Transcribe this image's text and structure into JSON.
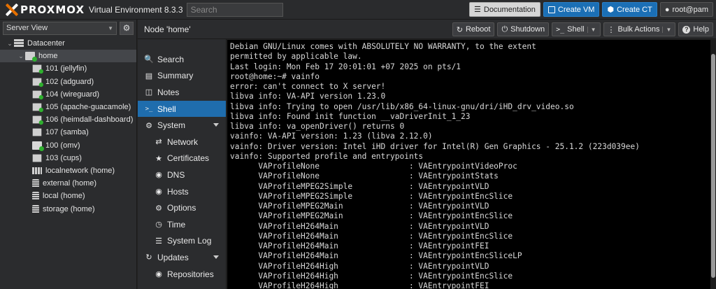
{
  "topbar": {
    "logo": "PROXMOX",
    "version": "Virtual Environment 8.3.3",
    "search_placeholder": "Search",
    "documentation": "Documentation",
    "create_vm": "Create VM",
    "create_ct": "Create CT",
    "user": "root@pam"
  },
  "left": {
    "view": "Server View",
    "tree": [
      {
        "label": "Datacenter",
        "type": "datacenter",
        "indent": 0
      },
      {
        "label": "home",
        "type": "node",
        "indent": 1
      },
      {
        "label": "101 (jellyfin)",
        "type": "vm",
        "indent": 2
      },
      {
        "label": "102 (adguard)",
        "type": "vm",
        "indent": 2
      },
      {
        "label": "104 (wireguard)",
        "type": "vm",
        "indent": 2
      },
      {
        "label": "105 (apache-guacamole)",
        "type": "vm",
        "indent": 2
      },
      {
        "label": "106 (heimdall-dashboard)",
        "type": "vm",
        "indent": 2
      },
      {
        "label": "107 (samba)",
        "type": "ct",
        "indent": 2
      },
      {
        "label": "100 (omv)",
        "type": "qemu",
        "indent": 2
      },
      {
        "label": "103 (cups)",
        "type": "ct-off",
        "indent": 2
      },
      {
        "label": "localnetwork (home)",
        "type": "net",
        "indent": 2
      },
      {
        "label": "external (home)",
        "type": "storage",
        "indent": 2
      },
      {
        "label": "local (home)",
        "type": "storage",
        "indent": 2
      },
      {
        "label": "storage (home)",
        "type": "storage",
        "indent": 2
      }
    ]
  },
  "node": {
    "title": "Node 'home'",
    "reboot": "Reboot",
    "shutdown": "Shutdown",
    "shell": "Shell",
    "bulk": "Bulk Actions",
    "help": "Help"
  },
  "menu": [
    {
      "label": "Search",
      "icon": "search-icon",
      "sub": false
    },
    {
      "label": "Summary",
      "icon": "book-icon",
      "sub": false
    },
    {
      "label": "Notes",
      "icon": "notes-icon",
      "sub": false
    },
    {
      "label": "Shell",
      "icon": "terminal-icon",
      "sub": false,
      "active": true
    },
    {
      "label": "System",
      "icon": "cogs-icon",
      "sub": false,
      "expand": true
    },
    {
      "label": "Network",
      "icon": "network-icon",
      "sub": true
    },
    {
      "label": "Certificates",
      "icon": "certificate-icon",
      "sub": true
    },
    {
      "label": "DNS",
      "icon": "globe-icon",
      "sub": true
    },
    {
      "label": "Hosts",
      "icon": "globe-icon",
      "sub": true
    },
    {
      "label": "Options",
      "icon": "gear-icon",
      "sub": true
    },
    {
      "label": "Time",
      "icon": "clock-icon",
      "sub": true
    },
    {
      "label": "System Log",
      "icon": "list-icon",
      "sub": true
    },
    {
      "label": "Updates",
      "icon": "refresh-icon",
      "sub": false,
      "expand": true
    },
    {
      "label": "Repositories",
      "icon": "globe-icon",
      "sub": true
    }
  ],
  "terminal": [
    "Debian GNU/Linux comes with ABSOLUTELY NO WARRANTY, to the extent",
    "permitted by applicable law.",
    "Last login: Mon Feb 17 20:01:01 +07 2025 on pts/1",
    "root@home:~# vainfo",
    "error: can't connect to X server!",
    "libva info: VA-API version 1.23.0",
    "libva info: Trying to open /usr/lib/x86_64-linux-gnu/dri/iHD_drv_video.so",
    "libva info: Found init function __vaDriverInit_1_23",
    "libva info: va_openDriver() returns 0",
    "vainfo: VA-API version: 1.23 (libva 2.12.0)",
    "vainfo: Driver version: Intel iHD driver for Intel(R) Gen Graphics - 25.1.2 (223d039ee)",
    "vainfo: Supported profile and entrypoints",
    "      VAProfileNone                   : VAEntrypointVideoProc",
    "      VAProfileNone                   : VAEntrypointStats",
    "      VAProfileMPEG2Simple            : VAEntrypointVLD",
    "      VAProfileMPEG2Simple            : VAEntrypointEncSlice",
    "      VAProfileMPEG2Main              : VAEntrypointVLD",
    "      VAProfileMPEG2Main              : VAEntrypointEncSlice",
    "      VAProfileH264Main               : VAEntrypointVLD",
    "      VAProfileH264Main               : VAEntrypointEncSlice",
    "      VAProfileH264Main               : VAEntrypointFEI",
    "      VAProfileH264Main               : VAEntrypointEncSliceLP",
    "      VAProfileH264High               : VAEntrypointVLD",
    "      VAProfileH264High               : VAEntrypointEncSlice",
    "      VAProfileH264High               : VAEntrypointFEI"
  ]
}
